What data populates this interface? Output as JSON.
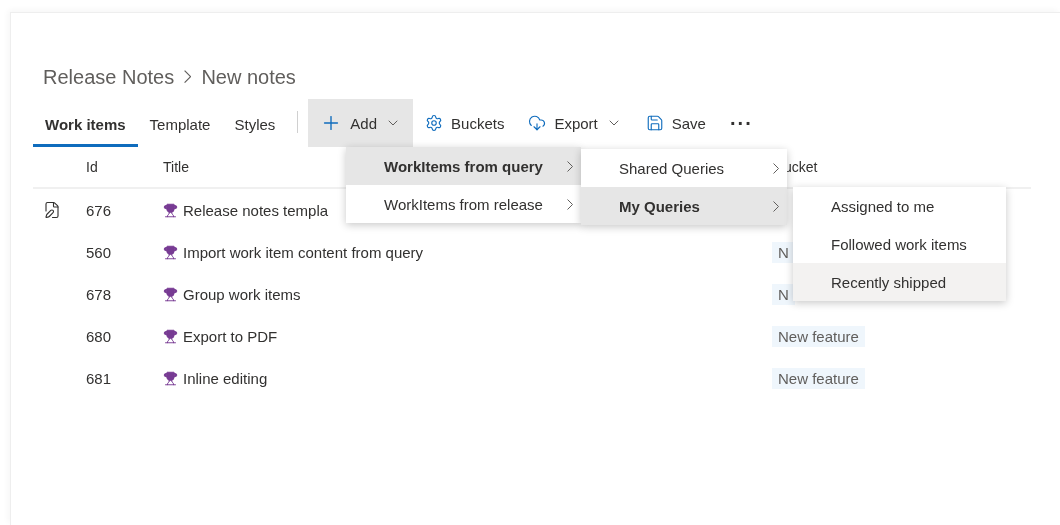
{
  "breadcrumb": [
    "Release Notes",
    "New notes"
  ],
  "tabs": [
    {
      "label": "Work items",
      "selected": true
    },
    {
      "label": "Template",
      "selected": false
    },
    {
      "label": "Styles",
      "selected": false
    }
  ],
  "toolbar": [
    {
      "kind": "add",
      "label": "Add",
      "active": true
    },
    {
      "kind": "buckets",
      "label": "Buckets",
      "active": false
    },
    {
      "kind": "export",
      "label": "Export",
      "active": false
    },
    {
      "kind": "save",
      "label": "Save",
      "active": false
    },
    {
      "kind": "more",
      "label": "···",
      "active": false
    }
  ],
  "table": {
    "columns": [
      "Id",
      "Title",
      "ucket"
    ],
    "rows": [
      {
        "id": "676",
        "title": "Release notes templa",
        "editing": true
      },
      {
        "id": "560",
        "title": "Import work item content from query",
        "editing": false,
        "bucket": "N"
      },
      {
        "id": "678",
        "title": "Group work items",
        "editing": false,
        "bucket": "N"
      },
      {
        "id": "680",
        "title": "Export to PDF",
        "editing": false,
        "bucket": "New feature"
      },
      {
        "id": "681",
        "title": "Inline editing",
        "editing": false,
        "bucket": "New feature"
      }
    ]
  },
  "menus": [
    {
      "items": [
        {
          "label": "WorkItems from query",
          "selected": true,
          "submenu": true
        },
        {
          "label": "WorkItems from release",
          "selected": false,
          "submenu": true
        }
      ]
    },
    {
      "items": [
        {
          "label": "Shared Queries",
          "selected": false,
          "submenu": true
        },
        {
          "label": "My Queries",
          "selected": true,
          "submenu": true
        }
      ]
    },
    {
      "items": [
        {
          "label": "Assigned to me",
          "selected": false,
          "submenu": false
        },
        {
          "label": "Followed work items",
          "selected": false,
          "submenu": false
        },
        {
          "label": "Recently shipped",
          "selected": true,
          "submenu": false
        }
      ]
    }
  ]
}
